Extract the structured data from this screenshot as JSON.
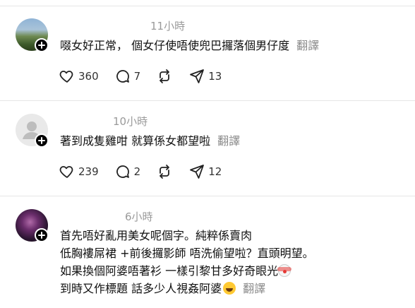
{
  "comments": [
    {
      "time": "11小時",
      "text": "啜女好正常， 個女仔使唔使兜巴攞落個男仔度",
      "translate": "翻譯",
      "likes": "360",
      "replies": "7",
      "shares": "13",
      "avatar": "photo"
    },
    {
      "time": "10小時",
      "text": "著到成隻雞咁 就算係女都望啦",
      "translate": "翻譯",
      "likes": "239",
      "replies": "2",
      "shares": "12",
      "avatar": "placeholder"
    },
    {
      "time": "6小時",
      "lines": [
        "首先唔好亂用美女呢個字。純粹係賣肉",
        "低胸褸屌裙 +前後攞影師 唔洗偷望啦？直頭明望。",
        "如果換個阿婆唔著衫 一樣引黎甘多好奇眼光",
        "到時又作標題 話多少人視姦阿婆"
      ],
      "emojis": [
        "clown-face",
        "grinning-sweat"
      ],
      "translate": "翻譯",
      "avatar": "photo"
    }
  ],
  "icons": {
    "like": "heart-icon",
    "reply": "comment-icon",
    "repost": "repost-icon",
    "share": "send-icon",
    "follow": "plus-icon"
  }
}
